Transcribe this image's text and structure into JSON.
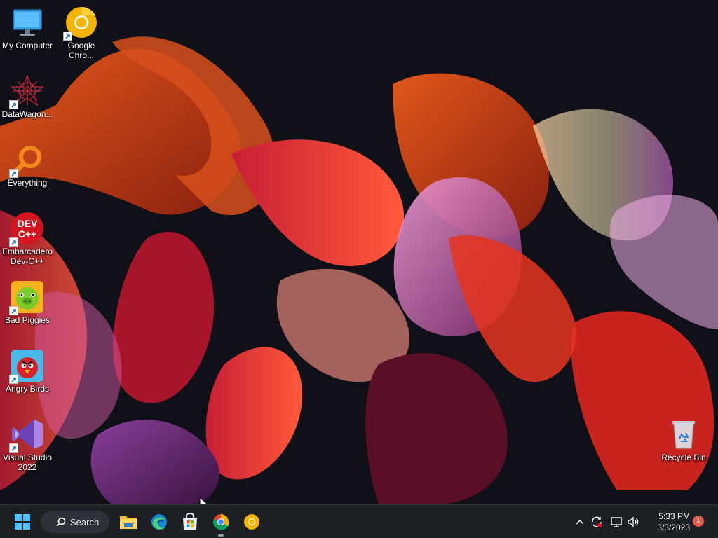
{
  "desktop": {
    "icons": [
      {
        "label": "My Computer",
        "icon": "monitor-icon"
      },
      {
        "label": "Google\nChro...",
        "icon": "chrome-canary-icon"
      },
      {
        "label": "DataWagon...",
        "icon": "datawagon-icon"
      },
      {
        "label": "Everything",
        "icon": "everything-search-icon"
      },
      {
        "label": "Embarcadero\nDev-C++",
        "icon": "devcpp-icon"
      },
      {
        "label": "Bad Piggies",
        "icon": "bad-piggies-icon"
      },
      {
        "label": "Angry Birds",
        "icon": "angry-birds-icon"
      },
      {
        "label": "Visual Studio\n2022",
        "icon": "visual-studio-icon"
      },
      {
        "label": "Recycle Bin",
        "icon": "recycle-bin-icon"
      }
    ]
  },
  "taskbar": {
    "search_label": "Search",
    "pinned": [
      "start-icon",
      "file-explorer-icon",
      "edge-icon",
      "microsoft-store-icon",
      "chrome-icon",
      "chrome-canary-icon"
    ],
    "tray": {
      "time": "5:33 PM",
      "date": "3/3/2023",
      "notification_count": "1"
    }
  },
  "colors": {
    "taskbar_bg": "#1c1f24",
    "search_bg": "#2d3138",
    "badge": "#e35a4a",
    "wallpaper_bg": "#0f1018"
  }
}
